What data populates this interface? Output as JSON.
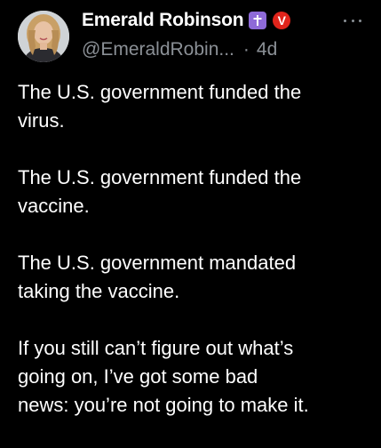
{
  "author": {
    "display_name": "Emerald Robinson",
    "handle": "@EmeraldRobin...",
    "separator": "·",
    "timestamp": "4d",
    "badges": [
      "cross-icon",
      "v-icon"
    ],
    "badge_v_label": "V"
  },
  "colors": {
    "background": "#000000",
    "text": "#ffffff",
    "muted": "#8b9096",
    "cross_badge": "#8e6ad8",
    "v_badge": "#e0241b"
  },
  "tweet": {
    "paragraphs": [
      "The U.S. government funded the\nvirus.",
      "The U.S. government funded the\nvaccine.",
      "The U.S. government mandated\ntaking the vaccine.",
      "If you still can’t figure out what’s\ngoing on, I’ve got some bad\nnews:  you’re not going to make it."
    ]
  },
  "icons": {
    "more": "more-options-icon"
  }
}
